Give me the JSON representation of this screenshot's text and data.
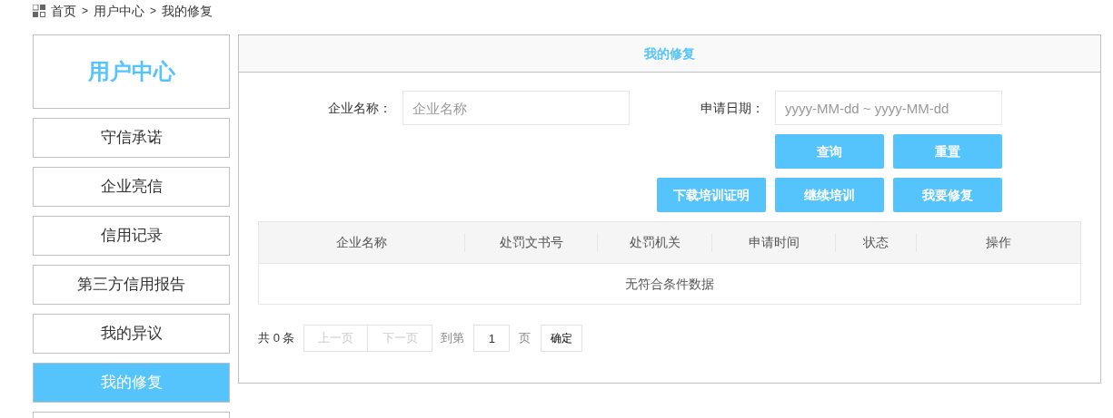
{
  "breadcrumb": [
    "首页",
    "用户中心",
    "我的修复"
  ],
  "breadcrumb_separator": ">",
  "sidebar": {
    "title": "用户中心",
    "items": [
      {
        "label": "守信承诺",
        "selected": false
      },
      {
        "label": "企业亮信",
        "selected": false
      },
      {
        "label": "信用记录",
        "selected": false
      },
      {
        "label": "第三方信用报告",
        "selected": false
      },
      {
        "label": "我的异议",
        "selected": false
      },
      {
        "label": "我的修复",
        "selected": true
      }
    ]
  },
  "panel": {
    "title": "我的修复",
    "fields": [
      {
        "label": "企业名称：",
        "placeholder": "企业名称"
      },
      {
        "label": "申请日期：",
        "placeholder": "yyyy-MM-dd ~ yyyy-MM-dd"
      }
    ],
    "button_rows": [
      [
        "查询",
        "重置"
      ],
      [
        "下载培训证明",
        "继续培训",
        "我要修复"
      ]
    ],
    "table": {
      "columns": [
        "企业名称",
        "处罚文书号",
        "处罚机关",
        "申请时间",
        "状态",
        "操作"
      ],
      "empty_text": "无符合条件数据"
    },
    "pagination": {
      "total_prefix": "共",
      "total": "0",
      "total_suffix": "条",
      "prev": "上一页",
      "next": "下一页",
      "prev_disabled": true,
      "next_disabled": true,
      "goto_label": "到第",
      "page": "1",
      "page_suffix": "页",
      "confirm": "确定"
    }
  }
}
